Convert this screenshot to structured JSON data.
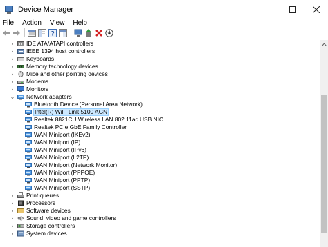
{
  "window": {
    "title": "Device Manager",
    "minimize_icon": "minimize-icon",
    "maximize_icon": "maximize-icon",
    "close_icon": "close-icon"
  },
  "menu": {
    "items": [
      "File",
      "Action",
      "View",
      "Help"
    ]
  },
  "toolbar": {
    "buttons": [
      "back-arrow-icon",
      "forward-arrow-icon",
      "properties-icon",
      "show-hide-console-tree-icon",
      "help-icon",
      "properties-pane-icon",
      "scan-hardware-icon",
      "update-driver-icon",
      "uninstall-device-icon",
      "download-driver-icon"
    ]
  },
  "tree": {
    "rows": [
      {
        "type": "cat",
        "expander": "›",
        "icon": "ide-controller-icon",
        "label": "IDE ATA/ATAPI controllers"
      },
      {
        "type": "cat",
        "expander": "›",
        "icon": "ieee1394-icon",
        "label": "IEEE 1394 host controllers"
      },
      {
        "type": "cat",
        "expander": "›",
        "icon": "keyboard-icon",
        "label": "Keyboards"
      },
      {
        "type": "cat",
        "expander": "›",
        "icon": "memory-icon",
        "label": "Memory technology devices"
      },
      {
        "type": "cat",
        "expander": "›",
        "icon": "mouse-icon",
        "label": "Mice and other pointing devices"
      },
      {
        "type": "cat",
        "expander": "›",
        "icon": "modem-icon",
        "label": "Modems"
      },
      {
        "type": "cat",
        "expander": "›",
        "icon": "monitor-icon",
        "label": "Monitors"
      },
      {
        "type": "cat",
        "expander": "⌄",
        "icon": "network-adapter-icon",
        "label": "Network adapters"
      },
      {
        "type": "dev",
        "icon": "network-adapter-icon",
        "label": "Bluetooth Device (Personal Area Network)"
      },
      {
        "type": "dev",
        "icon": "network-adapter-icon",
        "label": "Intel(R) WiFi Link 5100 AGN",
        "selected": true
      },
      {
        "type": "dev",
        "icon": "network-adapter-icon",
        "label": "Realtek 8821CU Wireless LAN 802.11ac USB NIC"
      },
      {
        "type": "dev",
        "icon": "network-adapter-icon",
        "label": "Realtek PCIe GbE Family Controller"
      },
      {
        "type": "dev",
        "icon": "network-adapter-icon",
        "label": "WAN Miniport (IKEv2)"
      },
      {
        "type": "dev",
        "icon": "network-adapter-icon",
        "label": "WAN Miniport (IP)"
      },
      {
        "type": "dev",
        "icon": "network-adapter-icon",
        "label": "WAN Miniport (IPv6)"
      },
      {
        "type": "dev",
        "icon": "network-adapter-icon",
        "label": "WAN Miniport (L2TP)"
      },
      {
        "type": "dev",
        "icon": "network-adapter-icon",
        "label": "WAN Miniport (Network Monitor)"
      },
      {
        "type": "dev",
        "icon": "network-adapter-icon",
        "label": "WAN Miniport (PPPOE)"
      },
      {
        "type": "dev",
        "icon": "network-adapter-icon",
        "label": "WAN Miniport (PPTP)"
      },
      {
        "type": "dev",
        "icon": "network-adapter-icon",
        "label": "WAN Miniport (SSTP)"
      },
      {
        "type": "cat",
        "expander": "›",
        "icon": "printer-icon",
        "label": "Print queues"
      },
      {
        "type": "cat",
        "expander": "›",
        "icon": "processor-icon",
        "label": "Processors"
      },
      {
        "type": "cat",
        "expander": "›",
        "icon": "software-device-icon",
        "label": "Software devices"
      },
      {
        "type": "cat",
        "expander": "›",
        "icon": "speaker-icon",
        "label": "Sound, video and game controllers"
      },
      {
        "type": "cat",
        "expander": "›",
        "icon": "storage-controller-icon",
        "label": "Storage controllers"
      },
      {
        "type": "cat",
        "expander": "›",
        "icon": "system-devices-icon",
        "label": "System devices"
      }
    ]
  },
  "colors": {
    "selection_bg": "#cce8ff",
    "selection_border": "#99d1ff",
    "network_icon": "#2f7fd0"
  }
}
